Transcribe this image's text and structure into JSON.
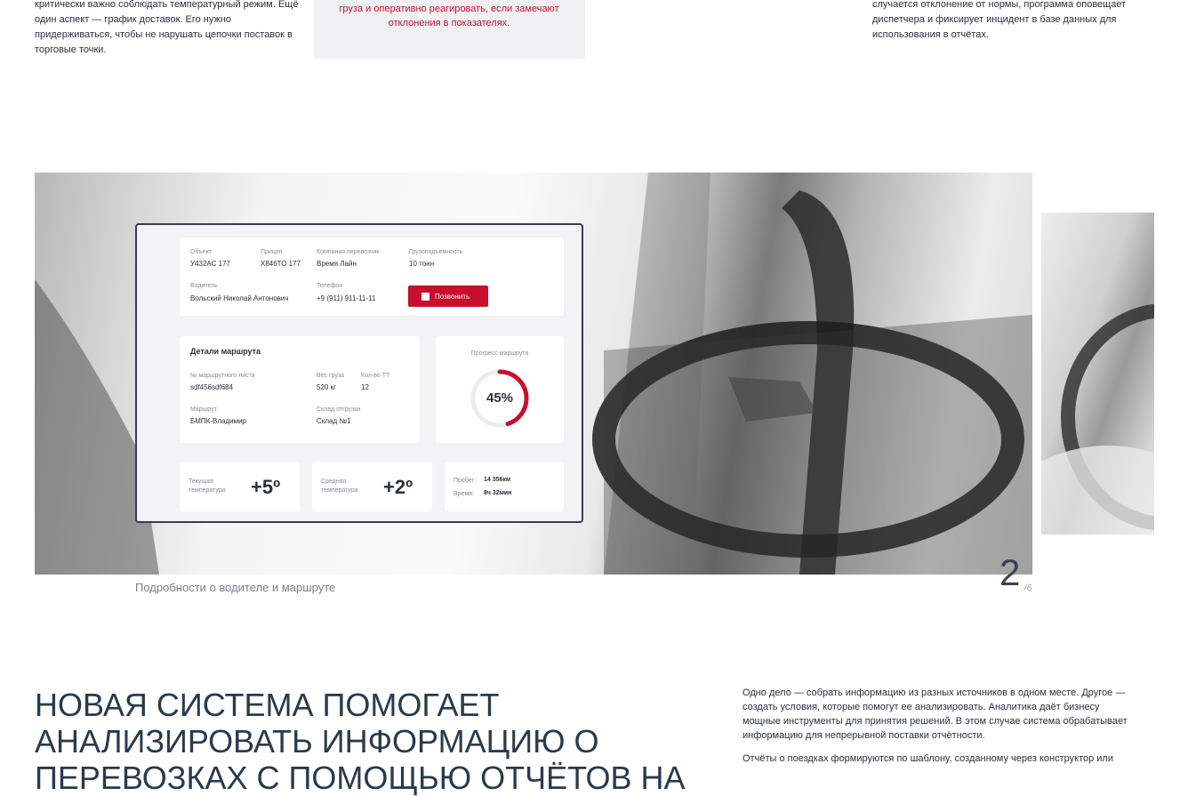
{
  "top": {
    "left_text": "критически важно соблюдать температурный режим. Ещё один аспект — график доставок. Его нужно придерживаться, чтобы не нарушать цепочки поставок в торговые точки.",
    "mid_text": "груза и оперативно реагировать, если замечают отклонения в показателях.",
    "right_text": "случается отклонение от нормы, программа оповещает диспетчера и фиксирует инцидент в базе данных для использования в отчётах."
  },
  "dashboard": {
    "object_label": "Объект",
    "object_value": "У432АС 177",
    "trailer_label": "Прицеп",
    "trailer_value": "Х846ТО 177",
    "carrier_label": "Компания перевозчик",
    "carrier_value": "Время Лайн",
    "capacity_label": "Грузоподъемность",
    "capacity_value": "10 тонн",
    "driver_label": "Водитель",
    "driver_value": "Вольский Николай Антонович",
    "phone_label": "Телефон",
    "phone_value": "+9 (911) 911-11-11",
    "call_button": "Позвонить",
    "route_title": "Детали маршрута",
    "waybill_label": "№ маршрутного листа",
    "waybill_value": "sdf456sdf684",
    "weight_label": "Вес груза",
    "weight_value": "520 кг",
    "points_label": "Кол-во ТТ",
    "points_value": "12",
    "route_label": "Маршрут",
    "route_value": "БМПК-Владимир",
    "warehouse_label": "Склад отгрузки",
    "warehouse_value": "Склад №1",
    "progress_label": "Прогресс маршрута",
    "progress_text": "45%",
    "progress_fraction": 0.45,
    "cur_temp_label_1": "Текущая",
    "cur_temp_label_2": "температура",
    "cur_temp_value": "+5º",
    "avg_temp_label_1": "Средняя",
    "avg_temp_label_2": "температура",
    "avg_temp_value": "+2º",
    "mileage_label": "Пробег:",
    "mileage_value": "14 356км",
    "time_label": "Время:",
    "time_value": "8ч 32мин",
    "accent_color": "#c8102e"
  },
  "slider": {
    "caption": "Подробности о водителе и маршруте",
    "current": "2",
    "total": "/6"
  },
  "section": {
    "headline": "Новая система помогает анализировать информацию о перевозках с помощью отчётов на",
    "para1": "Одно дело — собрать информацию из разных источников в одном месте. Другое — создать условия, которые помогут ее анализировать. Аналитика даёт бизнесу мощные инструменты для принятия решений. В этом случае система обрабатывает информацию для непрерывной поставки отчётности.",
    "para2": "Отчёты о поездках формируются по шаблону, созданному через конструктор или"
  }
}
